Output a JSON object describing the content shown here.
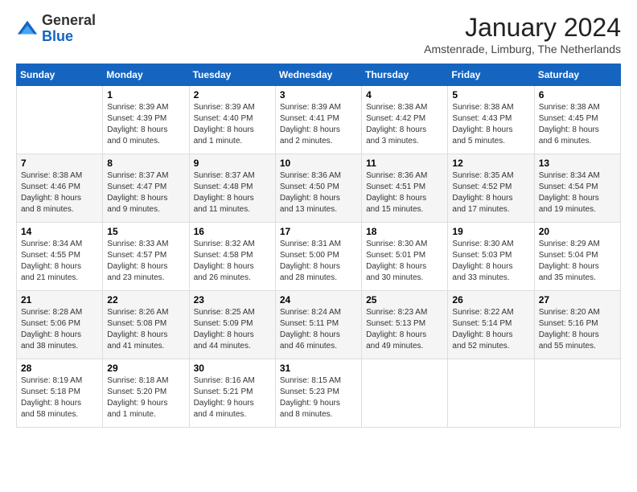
{
  "header": {
    "logo_general": "General",
    "logo_blue": "Blue",
    "month_title": "January 2024",
    "location": "Amstenrade, Limburg, The Netherlands"
  },
  "columns": [
    "Sunday",
    "Monday",
    "Tuesday",
    "Wednesday",
    "Thursday",
    "Friday",
    "Saturday"
  ],
  "weeks": [
    [
      {
        "day": "",
        "info": ""
      },
      {
        "day": "1",
        "info": "Sunrise: 8:39 AM\nSunset: 4:39 PM\nDaylight: 8 hours\nand 0 minutes."
      },
      {
        "day": "2",
        "info": "Sunrise: 8:39 AM\nSunset: 4:40 PM\nDaylight: 8 hours\nand 1 minute."
      },
      {
        "day": "3",
        "info": "Sunrise: 8:39 AM\nSunset: 4:41 PM\nDaylight: 8 hours\nand 2 minutes."
      },
      {
        "day": "4",
        "info": "Sunrise: 8:38 AM\nSunset: 4:42 PM\nDaylight: 8 hours\nand 3 minutes."
      },
      {
        "day": "5",
        "info": "Sunrise: 8:38 AM\nSunset: 4:43 PM\nDaylight: 8 hours\nand 5 minutes."
      },
      {
        "day": "6",
        "info": "Sunrise: 8:38 AM\nSunset: 4:45 PM\nDaylight: 8 hours\nand 6 minutes."
      }
    ],
    [
      {
        "day": "7",
        "info": "Sunrise: 8:38 AM\nSunset: 4:46 PM\nDaylight: 8 hours\nand 8 minutes."
      },
      {
        "day": "8",
        "info": "Sunrise: 8:37 AM\nSunset: 4:47 PM\nDaylight: 8 hours\nand 9 minutes."
      },
      {
        "day": "9",
        "info": "Sunrise: 8:37 AM\nSunset: 4:48 PM\nDaylight: 8 hours\nand 11 minutes."
      },
      {
        "day": "10",
        "info": "Sunrise: 8:36 AM\nSunset: 4:50 PM\nDaylight: 8 hours\nand 13 minutes."
      },
      {
        "day": "11",
        "info": "Sunrise: 8:36 AM\nSunset: 4:51 PM\nDaylight: 8 hours\nand 15 minutes."
      },
      {
        "day": "12",
        "info": "Sunrise: 8:35 AM\nSunset: 4:52 PM\nDaylight: 8 hours\nand 17 minutes."
      },
      {
        "day": "13",
        "info": "Sunrise: 8:34 AM\nSunset: 4:54 PM\nDaylight: 8 hours\nand 19 minutes."
      }
    ],
    [
      {
        "day": "14",
        "info": "Sunrise: 8:34 AM\nSunset: 4:55 PM\nDaylight: 8 hours\nand 21 minutes."
      },
      {
        "day": "15",
        "info": "Sunrise: 8:33 AM\nSunset: 4:57 PM\nDaylight: 8 hours\nand 23 minutes."
      },
      {
        "day": "16",
        "info": "Sunrise: 8:32 AM\nSunset: 4:58 PM\nDaylight: 8 hours\nand 26 minutes."
      },
      {
        "day": "17",
        "info": "Sunrise: 8:31 AM\nSunset: 5:00 PM\nDaylight: 8 hours\nand 28 minutes."
      },
      {
        "day": "18",
        "info": "Sunrise: 8:30 AM\nSunset: 5:01 PM\nDaylight: 8 hours\nand 30 minutes."
      },
      {
        "day": "19",
        "info": "Sunrise: 8:30 AM\nSunset: 5:03 PM\nDaylight: 8 hours\nand 33 minutes."
      },
      {
        "day": "20",
        "info": "Sunrise: 8:29 AM\nSunset: 5:04 PM\nDaylight: 8 hours\nand 35 minutes."
      }
    ],
    [
      {
        "day": "21",
        "info": "Sunrise: 8:28 AM\nSunset: 5:06 PM\nDaylight: 8 hours\nand 38 minutes."
      },
      {
        "day": "22",
        "info": "Sunrise: 8:26 AM\nSunset: 5:08 PM\nDaylight: 8 hours\nand 41 minutes."
      },
      {
        "day": "23",
        "info": "Sunrise: 8:25 AM\nSunset: 5:09 PM\nDaylight: 8 hours\nand 44 minutes."
      },
      {
        "day": "24",
        "info": "Sunrise: 8:24 AM\nSunset: 5:11 PM\nDaylight: 8 hours\nand 46 minutes."
      },
      {
        "day": "25",
        "info": "Sunrise: 8:23 AM\nSunset: 5:13 PM\nDaylight: 8 hours\nand 49 minutes."
      },
      {
        "day": "26",
        "info": "Sunrise: 8:22 AM\nSunset: 5:14 PM\nDaylight: 8 hours\nand 52 minutes."
      },
      {
        "day": "27",
        "info": "Sunrise: 8:20 AM\nSunset: 5:16 PM\nDaylight: 8 hours\nand 55 minutes."
      }
    ],
    [
      {
        "day": "28",
        "info": "Sunrise: 8:19 AM\nSunset: 5:18 PM\nDaylight: 8 hours\nand 58 minutes."
      },
      {
        "day": "29",
        "info": "Sunrise: 8:18 AM\nSunset: 5:20 PM\nDaylight: 9 hours\nand 1 minute."
      },
      {
        "day": "30",
        "info": "Sunrise: 8:16 AM\nSunset: 5:21 PM\nDaylight: 9 hours\nand 4 minutes."
      },
      {
        "day": "31",
        "info": "Sunrise: 8:15 AM\nSunset: 5:23 PM\nDaylight: 9 hours\nand 8 minutes."
      },
      {
        "day": "",
        "info": ""
      },
      {
        "day": "",
        "info": ""
      },
      {
        "day": "",
        "info": ""
      }
    ]
  ]
}
